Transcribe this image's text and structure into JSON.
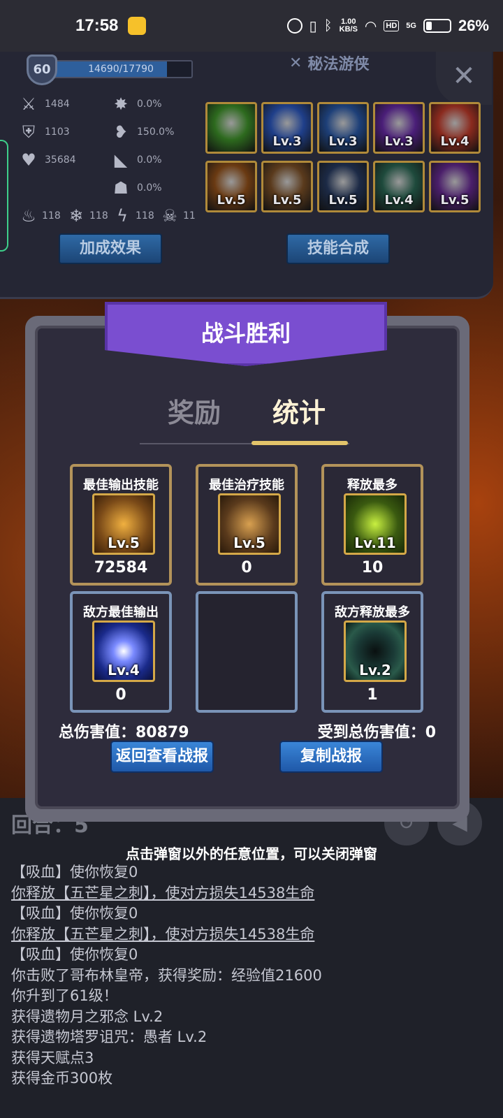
{
  "status_bar": {
    "time": "17:58",
    "net_speed_value": "1.00",
    "net_speed_unit": "KB/S",
    "hd": "HD",
    "signal": "5G",
    "battery": "26%"
  },
  "character": {
    "level": "60",
    "xp": "14690/17790",
    "xp_fraction": 0.826,
    "class_name": "秘法游侠",
    "stats": {
      "attack": "1484",
      "defense": "1103",
      "hp": "35684",
      "crit": "0.0%",
      "lifesteal": "150.0%",
      "dodge": "0.0%",
      "stun": "0.0%",
      "fire": "118",
      "ice": "118",
      "lightning": "118",
      "poison": "11"
    },
    "skills": [
      {
        "lv": "",
        "color": "#2d6a1e"
      },
      {
        "lv": "Lv.3",
        "color": "#1f3f8a"
      },
      {
        "lv": "Lv.3",
        "color": "#1d3f78"
      },
      {
        "lv": "Lv.3",
        "color": "#4a1e78"
      },
      {
        "lv": "Lv.4",
        "color": "#8a2a1e"
      },
      {
        "lv": "Lv.5",
        "color": "#6a3a12"
      },
      {
        "lv": "Lv.5",
        "color": "#5a3a1c"
      },
      {
        "lv": "Lv.5",
        "color": "#1c2a46"
      },
      {
        "lv": "Lv.4",
        "color": "#1e4a3c"
      },
      {
        "lv": "Lv.5",
        "color": "#4a1e6a"
      }
    ],
    "bonus_button": "加成效果",
    "synth_button": "技能合成"
  },
  "popup": {
    "title": "战斗胜利",
    "tab_rewards": "奖励",
    "tab_stats": "统计",
    "cards": [
      {
        "title": "最佳输出技能",
        "lv": "Lv.5",
        "value": "72584",
        "color": "#7a4a18"
      },
      {
        "title": "最佳治疗技能",
        "lv": "Lv.5",
        "value": "0",
        "color": "#5a3a1c"
      },
      {
        "title": "释放最多",
        "lv": "Lv.11",
        "value": "10",
        "color": "#3a5a10"
      },
      {
        "title": "敌方最佳输出",
        "lv": "Lv.4",
        "value": "0",
        "color": "#1a2a8a"
      },
      {
        "title": "敌方释放最多",
        "lv": "Lv.2",
        "value": "1",
        "color": "#1a3a36"
      }
    ],
    "total_damage": "总伤害值：80879",
    "received_damage": "受到总伤害值：0",
    "review_button": "返回查看战报",
    "copy_button": "复制战报"
  },
  "battle": {
    "round_label": "回合：5",
    "dismiss_hint": "点击弹窗以外的任意位置，可以关闭弹窗",
    "log": [
      {
        "text": "【吸血】使你恢复0",
        "u": false
      },
      {
        "text": "你释放【五芒星之刺】，使对方损失14538生命",
        "u": true
      },
      {
        "text": "【吸血】使你恢复0",
        "u": false
      },
      {
        "text": "你释放【五芒星之刺】，使对方损失14538生命",
        "u": true
      },
      {
        "text": "【吸血】使你恢复0",
        "u": false
      },
      {
        "text": "你击败了哥布林皇帝，获得奖励：经验值21600",
        "u": false
      },
      {
        "text": "你升到了61级！",
        "u": false
      },
      {
        "text": "获得遗物月之邪念 Lv.2",
        "u": false
      },
      {
        "text": "获得遗物塔罗诅咒：愚者 Lv.2",
        "u": false
      },
      {
        "text": "获得天赋点3",
        "u": false
      },
      {
        "text": "获得金币300枚",
        "u": false
      }
    ]
  }
}
